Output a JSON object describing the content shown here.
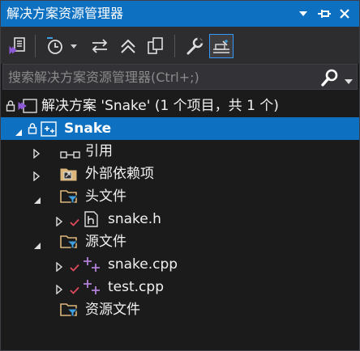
{
  "window": {
    "title": "解决方案资源管理器"
  },
  "search": {
    "placeholder": "搜索解决方案资源管理器(Ctrl+;)"
  },
  "tree": {
    "solution_label": "解决方案 'Snake' (1 个项目，共 1 个)",
    "project_label": "Snake",
    "references_label": "引用",
    "external_deps_label": "外部依赖项",
    "header_files_label": "头文件",
    "snake_h_label": "snake.h",
    "source_files_label": "源文件",
    "snake_cpp_label": "snake.cpp",
    "test_cpp_label": "test.cpp",
    "resource_files_label": "资源文件"
  },
  "colors": {
    "accent": "#0e70c0",
    "background": "#1b1b1c",
    "toolbar": "#2d2d30",
    "checkmark": "#e04a5a",
    "cpp_plus": "#b180d7",
    "folder": "#dcb67a"
  }
}
